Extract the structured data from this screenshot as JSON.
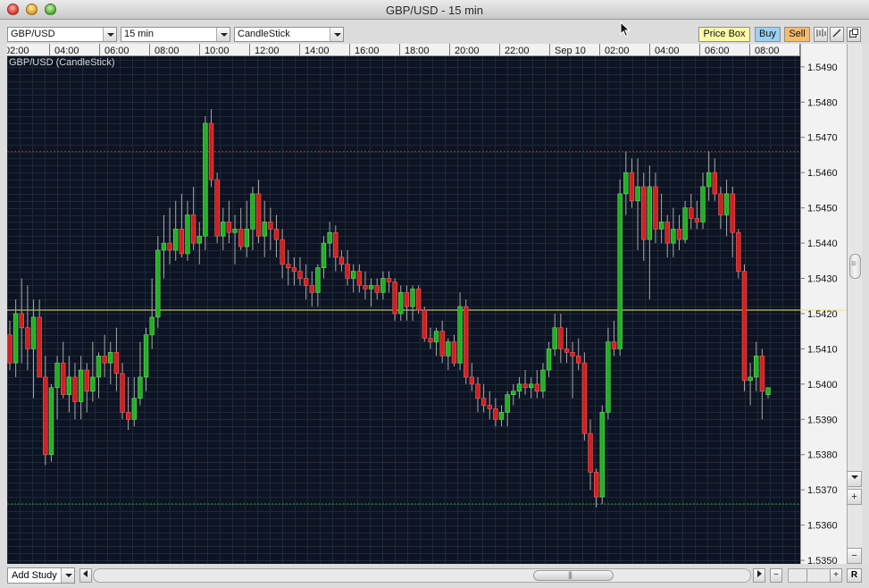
{
  "window": {
    "title": "GBP/USD - 15 min"
  },
  "toolbar": {
    "symbol": "GBP/USD",
    "interval": "15 min",
    "chart_style": "CandleStick",
    "price_box_label": "Price Box",
    "buy_label": "Buy",
    "sell_label": "Sell"
  },
  "bottom": {
    "add_study_label": "Add Study"
  },
  "colors": {
    "background": "#0d1322",
    "grid": "#1c2a3a",
    "up": "#22b022",
    "down": "#d02020",
    "wick": "#a8a8a8",
    "axis_text": "#111111",
    "current_price_line": "#e8e87a",
    "upper_line": "#b02020",
    "lower_line": "#20a020"
  },
  "chart_data": {
    "type": "candlestick",
    "series_label": "GBP/USD (CandleStick)",
    "x_ticks": [
      "02:00",
      "04:00",
      "06:00",
      "08:00",
      "10:00",
      "12:00",
      "14:00",
      "16:00",
      "18:00",
      "20:00",
      "22:00",
      "Sep 10",
      "02:00",
      "04:00",
      "06:00",
      "08:00"
    ],
    "y_ticks": [
      "1.5490",
      "1.5480",
      "1.5470",
      "1.5460",
      "1.5450",
      "1.5440",
      "1.5430",
      "1.5420",
      "1.5410",
      "1.5400",
      "1.5390",
      "1.5380",
      "1.5370",
      "1.5360",
      "1.5350"
    ],
    "ylim": [
      1.5349,
      1.5493
    ],
    "current_price": 1.5421,
    "upper_level": 1.5466,
    "lower_level": 1.5366,
    "candles": [
      {
        "o": 1.5414,
        "h": 1.5418,
        "l": 1.5404,
        "c": 1.5406
      },
      {
        "o": 1.5406,
        "h": 1.5424,
        "l": 1.5402,
        "c": 1.542
      },
      {
        "o": 1.542,
        "h": 1.543,
        "l": 1.5406,
        "c": 1.5416
      },
      {
        "o": 1.5416,
        "h": 1.5428,
        "l": 1.5404,
        "c": 1.541
      },
      {
        "o": 1.541,
        "h": 1.5424,
        "l": 1.5396,
        "c": 1.5419
      },
      {
        "o": 1.5419,
        "h": 1.5424,
        "l": 1.5402,
        "c": 1.5402
      },
      {
        "o": 1.5402,
        "h": 1.5408,
        "l": 1.5377,
        "c": 1.538
      },
      {
        "o": 1.538,
        "h": 1.54,
        "l": 1.5378,
        "c": 1.5399
      },
      {
        "o": 1.5399,
        "h": 1.5408,
        "l": 1.539,
        "c": 1.5406
      },
      {
        "o": 1.5406,
        "h": 1.5412,
        "l": 1.5396,
        "c": 1.5397
      },
      {
        "o": 1.5397,
        "h": 1.5408,
        "l": 1.5392,
        "c": 1.5402
      },
      {
        "o": 1.5402,
        "h": 1.5406,
        "l": 1.539,
        "c": 1.5395
      },
      {
        "o": 1.5395,
        "h": 1.5408,
        "l": 1.539,
        "c": 1.5404
      },
      {
        "o": 1.5404,
        "h": 1.5406,
        "l": 1.5392,
        "c": 1.5398
      },
      {
        "o": 1.5398,
        "h": 1.5412,
        "l": 1.5395,
        "c": 1.5402
      },
      {
        "o": 1.5402,
        "h": 1.5409,
        "l": 1.5396,
        "c": 1.5408
      },
      {
        "o": 1.5408,
        "h": 1.5414,
        "l": 1.5402,
        "c": 1.5406
      },
      {
        "o": 1.5406,
        "h": 1.5412,
        "l": 1.54,
        "c": 1.5409
      },
      {
        "o": 1.5409,
        "h": 1.5416,
        "l": 1.5398,
        "c": 1.5403
      },
      {
        "o": 1.5403,
        "h": 1.5406,
        "l": 1.539,
        "c": 1.5392
      },
      {
        "o": 1.5392,
        "h": 1.5402,
        "l": 1.5387,
        "c": 1.539
      },
      {
        "o": 1.539,
        "h": 1.5402,
        "l": 1.5388,
        "c": 1.5396
      },
      {
        "o": 1.5396,
        "h": 1.5412,
        "l": 1.5394,
        "c": 1.5402
      },
      {
        "o": 1.5402,
        "h": 1.5416,
        "l": 1.5398,
        "c": 1.5414
      },
      {
        "o": 1.5414,
        "h": 1.543,
        "l": 1.541,
        "c": 1.5419
      },
      {
        "o": 1.5419,
        "h": 1.5442,
        "l": 1.5416,
        "c": 1.5438
      },
      {
        "o": 1.5438,
        "h": 1.5448,
        "l": 1.543,
        "c": 1.544
      },
      {
        "o": 1.544,
        "h": 1.545,
        "l": 1.5434,
        "c": 1.5438
      },
      {
        "o": 1.5438,
        "h": 1.5452,
        "l": 1.5435,
        "c": 1.5444
      },
      {
        "o": 1.5444,
        "h": 1.5454,
        "l": 1.5436,
        "c": 1.5437
      },
      {
        "o": 1.5437,
        "h": 1.5452,
        "l": 1.5435,
        "c": 1.5448
      },
      {
        "o": 1.5448,
        "h": 1.5456,
        "l": 1.5438,
        "c": 1.544
      },
      {
        "o": 1.544,
        "h": 1.5446,
        "l": 1.5434,
        "c": 1.5442
      },
      {
        "o": 1.5442,
        "h": 1.5476,
        "l": 1.5438,
        "c": 1.5474
      },
      {
        "o": 1.5474,
        "h": 1.5478,
        "l": 1.5456,
        "c": 1.5458
      },
      {
        "o": 1.5458,
        "h": 1.546,
        "l": 1.544,
        "c": 1.5442
      },
      {
        "o": 1.5442,
        "h": 1.545,
        "l": 1.5438,
        "c": 1.5446
      },
      {
        "o": 1.5446,
        "h": 1.5452,
        "l": 1.544,
        "c": 1.5443
      },
      {
        "o": 1.5443,
        "h": 1.5448,
        "l": 1.5434,
        "c": 1.5444
      },
      {
        "o": 1.5444,
        "h": 1.545,
        "l": 1.5438,
        "c": 1.5439
      },
      {
        "o": 1.5439,
        "h": 1.5452,
        "l": 1.5436,
        "c": 1.5444
      },
      {
        "o": 1.5444,
        "h": 1.5456,
        "l": 1.5438,
        "c": 1.5454
      },
      {
        "o": 1.5454,
        "h": 1.5458,
        "l": 1.544,
        "c": 1.5442
      },
      {
        "o": 1.5442,
        "h": 1.5452,
        "l": 1.5436,
        "c": 1.5446
      },
      {
        "o": 1.5446,
        "h": 1.545,
        "l": 1.5438,
        "c": 1.5444
      },
      {
        "o": 1.5444,
        "h": 1.5448,
        "l": 1.5436,
        "c": 1.5441
      },
      {
        "o": 1.5441,
        "h": 1.5444,
        "l": 1.543,
        "c": 1.5434
      },
      {
        "o": 1.5434,
        "h": 1.5438,
        "l": 1.5428,
        "c": 1.5433
      },
      {
        "o": 1.5433,
        "h": 1.5436,
        "l": 1.5428,
        "c": 1.5432
      },
      {
        "o": 1.5432,
        "h": 1.5436,
        "l": 1.5428,
        "c": 1.543
      },
      {
        "o": 1.543,
        "h": 1.5434,
        "l": 1.5424,
        "c": 1.5428
      },
      {
        "o": 1.5428,
        "h": 1.5432,
        "l": 1.5422,
        "c": 1.5426
      },
      {
        "o": 1.5426,
        "h": 1.5434,
        "l": 1.5422,
        "c": 1.5433
      },
      {
        "o": 1.5433,
        "h": 1.5442,
        "l": 1.543,
        "c": 1.544
      },
      {
        "o": 1.544,
        "h": 1.5446,
        "l": 1.5436,
        "c": 1.5443
      },
      {
        "o": 1.5443,
        "h": 1.5445,
        "l": 1.5432,
        "c": 1.5436
      },
      {
        "o": 1.5436,
        "h": 1.5438,
        "l": 1.5432,
        "c": 1.5434
      },
      {
        "o": 1.5434,
        "h": 1.5438,
        "l": 1.5428,
        "c": 1.543
      },
      {
        "o": 1.543,
        "h": 1.5434,
        "l": 1.5426,
        "c": 1.5432
      },
      {
        "o": 1.5432,
        "h": 1.5434,
        "l": 1.5426,
        "c": 1.5428
      },
      {
        "o": 1.5428,
        "h": 1.5432,
        "l": 1.5424,
        "c": 1.5427
      },
      {
        "o": 1.5427,
        "h": 1.543,
        "l": 1.5422,
        "c": 1.5428
      },
      {
        "o": 1.5428,
        "h": 1.543,
        "l": 1.5424,
        "c": 1.5426
      },
      {
        "o": 1.5426,
        "h": 1.5432,
        "l": 1.5424,
        "c": 1.543
      },
      {
        "o": 1.543,
        "h": 1.5432,
        "l": 1.5426,
        "c": 1.5429
      },
      {
        "o": 1.5429,
        "h": 1.543,
        "l": 1.5418,
        "c": 1.542
      },
      {
        "o": 1.542,
        "h": 1.5428,
        "l": 1.5418,
        "c": 1.5426
      },
      {
        "o": 1.5426,
        "h": 1.5428,
        "l": 1.5418,
        "c": 1.5422
      },
      {
        "o": 1.5422,
        "h": 1.5428,
        "l": 1.5418,
        "c": 1.5427
      },
      {
        "o": 1.5427,
        "h": 1.5428,
        "l": 1.542,
        "c": 1.5421
      },
      {
        "o": 1.5421,
        "h": 1.5422,
        "l": 1.5412,
        "c": 1.5413
      },
      {
        "o": 1.5413,
        "h": 1.5416,
        "l": 1.541,
        "c": 1.5412
      },
      {
        "o": 1.5412,
        "h": 1.5416,
        "l": 1.5408,
        "c": 1.5415
      },
      {
        "o": 1.5415,
        "h": 1.5418,
        "l": 1.5406,
        "c": 1.5408
      },
      {
        "o": 1.5408,
        "h": 1.5413,
        "l": 1.5404,
        "c": 1.5412
      },
      {
        "o": 1.5412,
        "h": 1.5414,
        "l": 1.5405,
        "c": 1.5406
      },
      {
        "o": 1.5406,
        "h": 1.5426,
        "l": 1.5404,
        "c": 1.5422
      },
      {
        "o": 1.5422,
        "h": 1.5424,
        "l": 1.54,
        "c": 1.5402
      },
      {
        "o": 1.5402,
        "h": 1.5406,
        "l": 1.5398,
        "c": 1.54
      },
      {
        "o": 1.54,
        "h": 1.5402,
        "l": 1.5392,
        "c": 1.5396
      },
      {
        "o": 1.5396,
        "h": 1.54,
        "l": 1.5392,
        "c": 1.5394
      },
      {
        "o": 1.5394,
        "h": 1.5398,
        "l": 1.539,
        "c": 1.5393
      },
      {
        "o": 1.5393,
        "h": 1.5396,
        "l": 1.5388,
        "c": 1.539
      },
      {
        "o": 1.539,
        "h": 1.5394,
        "l": 1.5388,
        "c": 1.5392
      },
      {
        "o": 1.5392,
        "h": 1.5398,
        "l": 1.5388,
        "c": 1.5397
      },
      {
        "o": 1.5397,
        "h": 1.54,
        "l": 1.5394,
        "c": 1.5398
      },
      {
        "o": 1.5398,
        "h": 1.5402,
        "l": 1.5396,
        "c": 1.54
      },
      {
        "o": 1.54,
        "h": 1.5404,
        "l": 1.5397,
        "c": 1.5399
      },
      {
        "o": 1.5399,
        "h": 1.5402,
        "l": 1.5396,
        "c": 1.54
      },
      {
        "o": 1.54,
        "h": 1.5404,
        "l": 1.5396,
        "c": 1.5398
      },
      {
        "o": 1.5398,
        "h": 1.5406,
        "l": 1.5396,
        "c": 1.5404
      },
      {
        "o": 1.5404,
        "h": 1.5412,
        "l": 1.5402,
        "c": 1.541
      },
      {
        "o": 1.541,
        "h": 1.542,
        "l": 1.5408,
        "c": 1.5416
      },
      {
        "o": 1.5416,
        "h": 1.542,
        "l": 1.5406,
        "c": 1.541
      },
      {
        "o": 1.541,
        "h": 1.5416,
        "l": 1.5406,
        "c": 1.5409
      },
      {
        "o": 1.5409,
        "h": 1.5412,
        "l": 1.5396,
        "c": 1.5408
      },
      {
        "o": 1.5408,
        "h": 1.5413,
        "l": 1.5404,
        "c": 1.5406
      },
      {
        "o": 1.5406,
        "h": 1.5409,
        "l": 1.5384,
        "c": 1.5386
      },
      {
        "o": 1.5386,
        "h": 1.539,
        "l": 1.537,
        "c": 1.5375
      },
      {
        "o": 1.5375,
        "h": 1.5376,
        "l": 1.5365,
        "c": 1.5368
      },
      {
        "o": 1.5368,
        "h": 1.5394,
        "l": 1.5366,
        "c": 1.5392
      },
      {
        "o": 1.5392,
        "h": 1.5416,
        "l": 1.539,
        "c": 1.5412
      },
      {
        "o": 1.5412,
        "h": 1.5418,
        "l": 1.5408,
        "c": 1.541
      },
      {
        "o": 1.541,
        "h": 1.5458,
        "l": 1.5408,
        "c": 1.5454
      },
      {
        "o": 1.5454,
        "h": 1.5466,
        "l": 1.5448,
        "c": 1.546
      },
      {
        "o": 1.546,
        "h": 1.5464,
        "l": 1.545,
        "c": 1.5452
      },
      {
        "o": 1.5452,
        "h": 1.5464,
        "l": 1.5438,
        "c": 1.5456
      },
      {
        "o": 1.5456,
        "h": 1.546,
        "l": 1.5435,
        "c": 1.5441
      },
      {
        "o": 1.5441,
        "h": 1.5462,
        "l": 1.5424,
        "c": 1.5456
      },
      {
        "o": 1.5456,
        "h": 1.546,
        "l": 1.544,
        "c": 1.5444
      },
      {
        "o": 1.5444,
        "h": 1.5454,
        "l": 1.544,
        "c": 1.5446
      },
      {
        "o": 1.5446,
        "h": 1.5448,
        "l": 1.5436,
        "c": 1.544
      },
      {
        "o": 1.544,
        "h": 1.545,
        "l": 1.5436,
        "c": 1.5444
      },
      {
        "o": 1.5444,
        "h": 1.5448,
        "l": 1.5438,
        "c": 1.5441
      },
      {
        "o": 1.5441,
        "h": 1.5452,
        "l": 1.544,
        "c": 1.545
      },
      {
        "o": 1.545,
        "h": 1.5454,
        "l": 1.5444,
        "c": 1.5447
      },
      {
        "o": 1.5447,
        "h": 1.5452,
        "l": 1.5444,
        "c": 1.5446
      },
      {
        "o": 1.5446,
        "h": 1.546,
        "l": 1.5444,
        "c": 1.5456
      },
      {
        "o": 1.5456,
        "h": 1.5466,
        "l": 1.5452,
        "c": 1.546
      },
      {
        "o": 1.546,
        "h": 1.5464,
        "l": 1.5452,
        "c": 1.5454
      },
      {
        "o": 1.5454,
        "h": 1.5456,
        "l": 1.5444,
        "c": 1.5448
      },
      {
        "o": 1.5448,
        "h": 1.5458,
        "l": 1.5442,
        "c": 1.5454
      },
      {
        "o": 1.5454,
        "h": 1.5456,
        "l": 1.5436,
        "c": 1.5443
      },
      {
        "o": 1.5443,
        "h": 1.5444,
        "l": 1.543,
        "c": 1.5432
      },
      {
        "o": 1.5432,
        "h": 1.5434,
        "l": 1.5398,
        "c": 1.5401
      },
      {
        "o": 1.5401,
        "h": 1.5406,
        "l": 1.5394,
        "c": 1.5402
      },
      {
        "o": 1.5402,
        "h": 1.5412,
        "l": 1.5398,
        "c": 1.5408
      },
      {
        "o": 1.5408,
        "h": 1.541,
        "l": 1.539,
        "c": 1.5398
      },
      {
        "o": 1.5397,
        "h": 1.5399,
        "l": 1.5396,
        "c": 1.5399
      }
    ]
  }
}
